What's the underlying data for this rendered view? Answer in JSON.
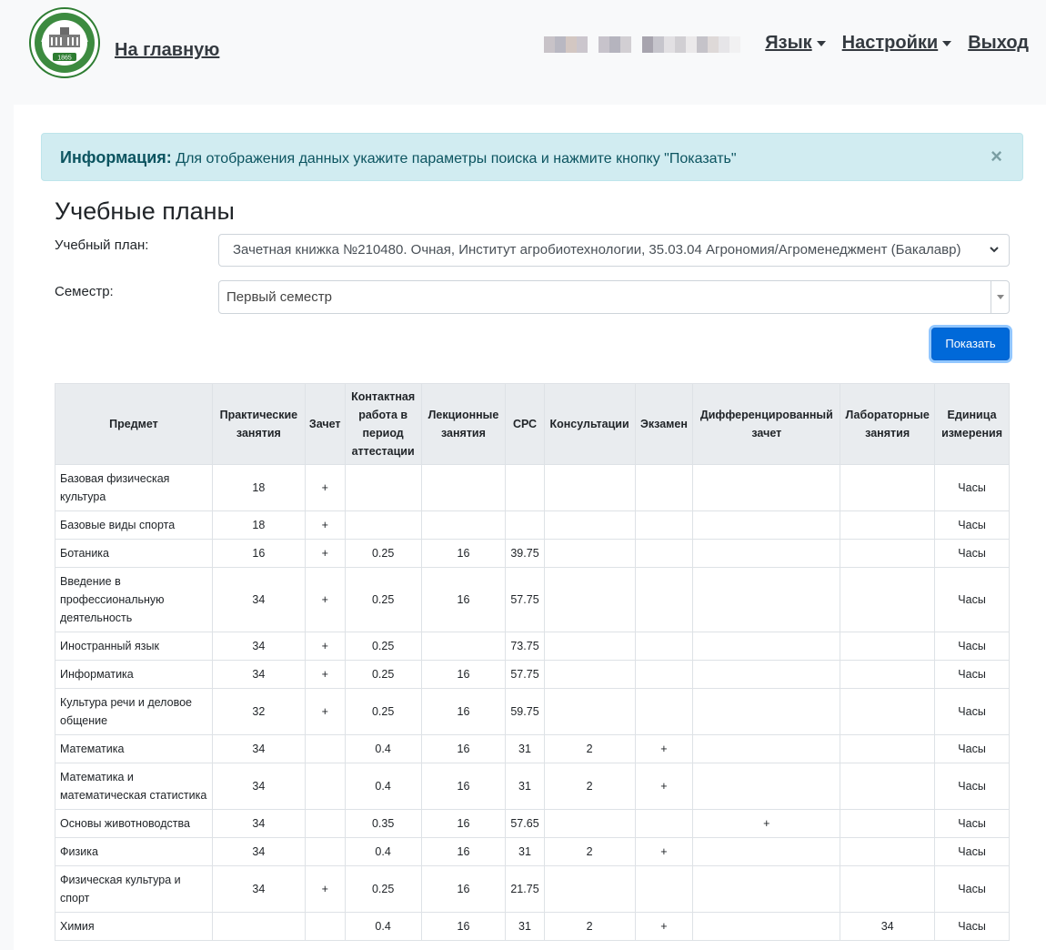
{
  "nav": {
    "home_label": "На главную",
    "language_label": "Язык",
    "settings_label": "Настройки",
    "logout_label": "Выход",
    "logo_year": "1865"
  },
  "alert": {
    "title": "Информация:",
    "message": "Для отображения данных укажите параметры поиска и нажмите кнопку \"Показать\"",
    "close": "×"
  },
  "page": {
    "title": "Учебные планы"
  },
  "form": {
    "plan_label": "Учебный план:",
    "plan_value": "Зачетная книжка №210480. Очная, Институт агробиотехнологии, 35.03.04 Агрономия/Агроменеджмент (Бакалавр)",
    "semester_label": "Семестр:",
    "semester_value": "Первый семестр",
    "show_button": "Показать"
  },
  "table": {
    "headers": [
      "Предмет",
      "Практические занятия",
      "Зачет",
      "Контактная работа в период аттестации",
      "Лекционные занятия",
      "СРС",
      "Консультации",
      "Экзамен",
      "Дифференцированный зачет",
      "Лабораторные занятия",
      "Единица измерения"
    ],
    "rows": [
      [
        "Базовая физическая культура",
        "18",
        "+",
        "",
        "",
        "",
        "",
        "",
        "",
        "",
        "Часы"
      ],
      [
        "Базовые виды спорта",
        "18",
        "+",
        "",
        "",
        "",
        "",
        "",
        "",
        "",
        "Часы"
      ],
      [
        "Ботаника",
        "16",
        "+",
        "0.25",
        "16",
        "39.75",
        "",
        "",
        "",
        "",
        "Часы"
      ],
      [
        "Введение в профессиональную деятельность",
        "34",
        "+",
        "0.25",
        "16",
        "57.75",
        "",
        "",
        "",
        "",
        "Часы"
      ],
      [
        "Иностранный язык",
        "34",
        "+",
        "0.25",
        "",
        "73.75",
        "",
        "",
        "",
        "",
        "Часы"
      ],
      [
        "Информатика",
        "34",
        "+",
        "0.25",
        "16",
        "57.75",
        "",
        "",
        "",
        "",
        "Часы"
      ],
      [
        "Культура речи и деловое общение",
        "32",
        "+",
        "0.25",
        "16",
        "59.75",
        "",
        "",
        "",
        "",
        "Часы"
      ],
      [
        "Математика",
        "34",
        "",
        "0.4",
        "16",
        "31",
        "2",
        "+",
        "",
        "",
        "Часы"
      ],
      [
        "Математика и математическая статистика",
        "34",
        "",
        "0.4",
        "16",
        "31",
        "2",
        "+",
        "",
        "",
        "Часы"
      ],
      [
        "Основы животноводства",
        "34",
        "",
        "0.35",
        "16",
        "57.65",
        "",
        "",
        "+",
        "",
        "Часы"
      ],
      [
        "Физика",
        "34",
        "",
        "0.4",
        "16",
        "31",
        "2",
        "+",
        "",
        "",
        "Часы"
      ],
      [
        "Физическая культура и спорт",
        "34",
        "+",
        "0.25",
        "16",
        "21.75",
        "",
        "",
        "",
        "",
        "Часы"
      ],
      [
        "Химия",
        "",
        "",
        "0.4",
        "16",
        "31",
        "2",
        "+",
        "",
        "34",
        "Часы"
      ]
    ]
  },
  "colors": {
    "primary": "#0069d9",
    "alert_bg": "#d1ecf1",
    "alert_text": "#0c5460",
    "logo_green": "#2e7d32"
  }
}
